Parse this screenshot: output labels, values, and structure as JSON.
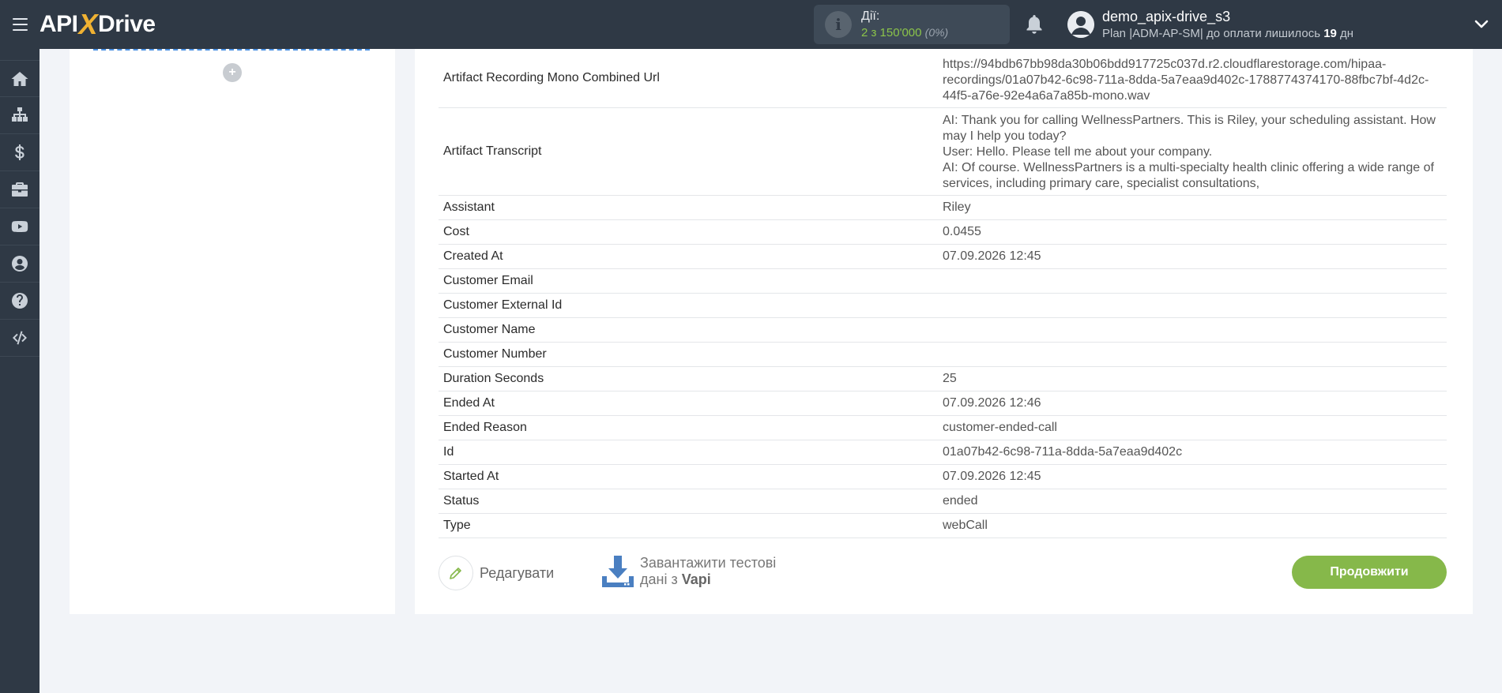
{
  "header": {
    "logo_left": "API",
    "logo_x": "X",
    "logo_right": "Drive",
    "actions_label": "Дії:",
    "actions_count": "2 з 150'000",
    "actions_percent": "(0%)",
    "user_name": "demo_apix-drive_s3",
    "plan_text": "Plan |ADM-AP-SM| до оплати лишилось",
    "days_value": "19",
    "days_unit": "дн"
  },
  "sidebar": {
    "items": [
      "home-icon",
      "sitemap-icon",
      "dollar-icon",
      "briefcase-icon",
      "youtube-icon",
      "user-icon",
      "help-icon",
      "code-icon"
    ]
  },
  "left_panel": {
    "add_symbol": "+"
  },
  "fields": [
    {
      "key": "Artifact Recording Mono Combined Url",
      "value": "https://94bdb67bb98da30b06bdd917725c037d.r2.cloudflarestorage.com/hipaa-recordings/01a07b42-6c98-711a-8dda-5a7eaa9d402c-1788774374170-88fbc7bf-4d2c-44f5-a76e-92e4a6a7a85b-mono.wav"
    },
    {
      "key": "Artifact Transcript",
      "value_lines": [
        "AI: Thank you for calling WellnessPartners. This is Riley, your scheduling assistant. How may I help you today?",
        "User: Hello. Please tell me about your company.",
        "AI: Of course. WellnessPartners is a multi-specialty health clinic offering a wide range of services, including primary care, specialist consultations,"
      ]
    },
    {
      "key": "Assistant",
      "value": "Riley"
    },
    {
      "key": "Cost",
      "value": "0.0455"
    },
    {
      "key": "Created At",
      "value": "07.09.2026 12:45"
    },
    {
      "key": "Customer Email",
      "value": ""
    },
    {
      "key": "Customer External Id",
      "value": ""
    },
    {
      "key": "Customer Name",
      "value": ""
    },
    {
      "key": "Customer Number",
      "value": ""
    },
    {
      "key": "Duration Seconds",
      "value": "25"
    },
    {
      "key": "Ended At",
      "value": "07.09.2026 12:46"
    },
    {
      "key": "Ended Reason",
      "value": "customer-ended-call"
    },
    {
      "key": "Id",
      "value": "01a07b42-6c98-711a-8dda-5a7eaa9d402c"
    },
    {
      "key": "Started At",
      "value": "07.09.2026 12:45"
    },
    {
      "key": "Status",
      "value": "ended"
    },
    {
      "key": "Type",
      "value": "webCall"
    }
  ],
  "footer": {
    "edit_label": "Редагувати",
    "download_line1": "Завантажити тестові",
    "download_line2_prefix": "дані з",
    "download_source": "Vapi",
    "continue_label": "Продовжити"
  },
  "colors": {
    "topbar": "#2f3945",
    "accent_green": "#86b84a",
    "actions_green": "#8bc34a",
    "logo_x": "#f0b232",
    "download_icon": "#4a7fc1",
    "dashed_line": "#4a90e2"
  }
}
